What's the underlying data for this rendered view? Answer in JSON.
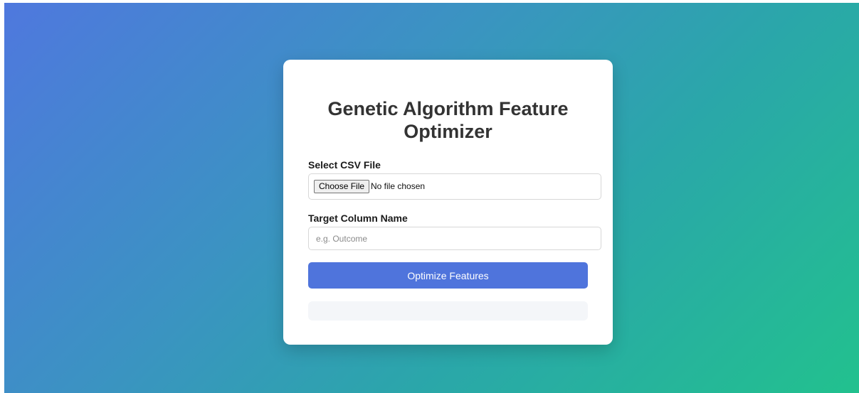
{
  "form": {
    "title": "Genetic Algorithm Feature Optimizer",
    "file_label": "Select CSV File",
    "choose_file_label": "Choose File",
    "file_status": "No file chosen",
    "target_label": "Target Column Name",
    "target_value": "",
    "target_placeholder": "e.g. Outcome",
    "submit_label": "Optimize Features",
    "result": ""
  },
  "colors": {
    "accent": "#4f74dc",
    "gradient_start": "#4f78de",
    "gradient_end": "#22c18e"
  }
}
